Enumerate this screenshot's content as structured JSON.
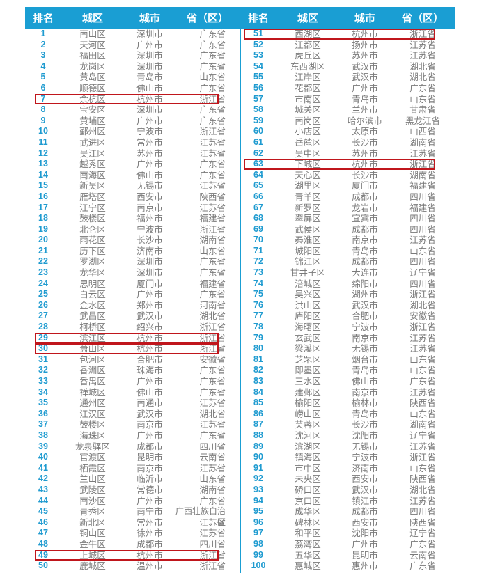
{
  "headers": {
    "rank": "排名",
    "district": "城区",
    "city": "城市",
    "province": "省（区）"
  },
  "colors": {
    "header_bg": "#1a9ed3",
    "rank_text": "#1f9bd0",
    "cell_text": "#7a7a7a",
    "highlight_border": "#c0161c"
  },
  "highlighted_ranks": [
    7,
    29,
    30,
    49,
    51,
    63
  ],
  "left_rows": [
    {
      "rank": "1",
      "district": "南山区",
      "city": "深圳市",
      "province": "广东省"
    },
    {
      "rank": "2",
      "district": "天河区",
      "city": "广州市",
      "province": "广东省"
    },
    {
      "rank": "3",
      "district": "福田区",
      "city": "深圳市",
      "province": "广东省"
    },
    {
      "rank": "4",
      "district": "龙岗区",
      "city": "深圳市",
      "province": "广东省"
    },
    {
      "rank": "5",
      "district": "黄岛区",
      "city": "青岛市",
      "province": "山东省"
    },
    {
      "rank": "6",
      "district": "顺德区",
      "city": "佛山市",
      "province": "广东省"
    },
    {
      "rank": "7",
      "district": "余杭区",
      "city": "杭州市",
      "province": "浙江省",
      "highlight": true
    },
    {
      "rank": "8",
      "district": "宝安区",
      "city": "深圳市",
      "province": "广东省"
    },
    {
      "rank": "9",
      "district": "黄埔区",
      "city": "广州市",
      "province": "广东省"
    },
    {
      "rank": "10",
      "district": "鄞州区",
      "city": "宁波市",
      "province": "浙江省"
    },
    {
      "rank": "11",
      "district": "武进区",
      "city": "常州市",
      "province": "江苏省"
    },
    {
      "rank": "12",
      "district": "吴江区",
      "city": "苏州市",
      "province": "江苏省"
    },
    {
      "rank": "13",
      "district": "越秀区",
      "city": "广州市",
      "province": "广东省"
    },
    {
      "rank": "14",
      "district": "南海区",
      "city": "佛山市",
      "province": "广东省"
    },
    {
      "rank": "15",
      "district": "新吴区",
      "city": "无锡市",
      "province": "江苏省"
    },
    {
      "rank": "16",
      "district": "雁塔区",
      "city": "西安市",
      "province": "陕西省"
    },
    {
      "rank": "17",
      "district": "江宁区",
      "city": "南京市",
      "province": "江苏省"
    },
    {
      "rank": "18",
      "district": "鼓楼区",
      "city": "福州市",
      "province": "福建省"
    },
    {
      "rank": "19",
      "district": "北仑区",
      "city": "宁波市",
      "province": "浙江省"
    },
    {
      "rank": "20",
      "district": "雨花区",
      "city": "长沙市",
      "province": "湖南省"
    },
    {
      "rank": "21",
      "district": "历下区",
      "city": "济南市",
      "province": "山东省"
    },
    {
      "rank": "22",
      "district": "罗湖区",
      "city": "深圳市",
      "province": "广东省"
    },
    {
      "rank": "23",
      "district": "龙华区",
      "city": "深圳市",
      "province": "广东省"
    },
    {
      "rank": "24",
      "district": "思明区",
      "city": "厦门市",
      "province": "福建省"
    },
    {
      "rank": "25",
      "district": "白云区",
      "city": "广州市",
      "province": "广东省"
    },
    {
      "rank": "26",
      "district": "金水区",
      "city": "郑州市",
      "province": "河南省"
    },
    {
      "rank": "27",
      "district": "武昌区",
      "city": "武汉市",
      "province": "湖北省"
    },
    {
      "rank": "28",
      "district": "柯桥区",
      "city": "绍兴市",
      "province": "浙江省"
    },
    {
      "rank": "29",
      "district": "滨江区",
      "city": "杭州市",
      "province": "浙江省",
      "highlight": true
    },
    {
      "rank": "30",
      "district": "萧山区",
      "city": "杭州市",
      "province": "浙江省",
      "highlight": true
    },
    {
      "rank": "31",
      "district": "包河区",
      "city": "合肥市",
      "province": "安徽省"
    },
    {
      "rank": "32",
      "district": "香洲区",
      "city": "珠海市",
      "province": "广东省"
    },
    {
      "rank": "33",
      "district": "番禺区",
      "city": "广州市",
      "province": "广东省"
    },
    {
      "rank": "34",
      "district": "禅城区",
      "city": "佛山市",
      "province": "广东省"
    },
    {
      "rank": "35",
      "district": "通州区",
      "city": "南通市",
      "province": "江苏省"
    },
    {
      "rank": "36",
      "district": "江汉区",
      "city": "武汉市",
      "province": "湖北省"
    },
    {
      "rank": "37",
      "district": "鼓楼区",
      "city": "南京市",
      "province": "江苏省"
    },
    {
      "rank": "38",
      "district": "海珠区",
      "city": "广州市",
      "province": "广东省"
    },
    {
      "rank": "39",
      "district": "龙泉驿区",
      "city": "成都市",
      "province": "四川省"
    },
    {
      "rank": "40",
      "district": "官渡区",
      "city": "昆明市",
      "province": "云南省"
    },
    {
      "rank": "41",
      "district": "栖霞区",
      "city": "南京市",
      "province": "江苏省"
    },
    {
      "rank": "42",
      "district": "兰山区",
      "city": "临沂市",
      "province": "山东省"
    },
    {
      "rank": "43",
      "district": "武陵区",
      "city": "常德市",
      "province": "湖南省"
    },
    {
      "rank": "44",
      "district": "南沙区",
      "city": "广州市",
      "province": "广东省"
    },
    {
      "rank": "45",
      "district": "青秀区",
      "city": "南宁市",
      "province": "广西壮族自治区"
    },
    {
      "rank": "46",
      "district": "新北区",
      "city": "常州市",
      "province": "江苏省"
    },
    {
      "rank": "47",
      "district": "铜山区",
      "city": "徐州市",
      "province": "江苏省"
    },
    {
      "rank": "48",
      "district": "金牛区",
      "city": "成都市",
      "province": "四川省"
    },
    {
      "rank": "49",
      "district": "上城区",
      "city": "杭州市",
      "province": "浙江省",
      "highlight": true
    },
    {
      "rank": "50",
      "district": "鹿城区",
      "city": "温州市",
      "province": "浙江省"
    }
  ],
  "right_rows": [
    {
      "rank": "51",
      "district": "西湖区",
      "city": "杭州市",
      "province": "浙江省",
      "highlight": true
    },
    {
      "rank": "52",
      "district": "江都区",
      "city": "扬州市",
      "province": "江苏省"
    },
    {
      "rank": "53",
      "district": "虎丘区",
      "city": "苏州市",
      "province": "江苏省"
    },
    {
      "rank": "54",
      "district": "东西湖区",
      "city": "武汉市",
      "province": "湖北省"
    },
    {
      "rank": "55",
      "district": "江岸区",
      "city": "武汉市",
      "province": "湖北省"
    },
    {
      "rank": "56",
      "district": "花都区",
      "city": "广州市",
      "province": "广东省"
    },
    {
      "rank": "57",
      "district": "市南区",
      "city": "青岛市",
      "province": "山东省"
    },
    {
      "rank": "58",
      "district": "城关区",
      "city": "兰州市",
      "province": "甘肃省"
    },
    {
      "rank": "59",
      "district": "南岗区",
      "city": "哈尔滨市",
      "province": "黑龙江省"
    },
    {
      "rank": "60",
      "district": "小店区",
      "city": "太原市",
      "province": "山西省"
    },
    {
      "rank": "61",
      "district": "岳麓区",
      "city": "长沙市",
      "province": "湖南省"
    },
    {
      "rank": "62",
      "district": "吴中区",
      "city": "苏州市",
      "province": "江苏省"
    },
    {
      "rank": "63",
      "district": "下城区",
      "city": "杭州市",
      "province": "浙江省",
      "highlight": true
    },
    {
      "rank": "64",
      "district": "天心区",
      "city": "长沙市",
      "province": "湖南省"
    },
    {
      "rank": "65",
      "district": "湖里区",
      "city": "厦门市",
      "province": "福建省"
    },
    {
      "rank": "66",
      "district": "青羊区",
      "city": "成都市",
      "province": "四川省"
    },
    {
      "rank": "67",
      "district": "新罗区",
      "city": "龙岩市",
      "province": "福建省"
    },
    {
      "rank": "68",
      "district": "翠屏区",
      "city": "宜宾市",
      "province": "四川省"
    },
    {
      "rank": "69",
      "district": "武侯区",
      "city": "成都市",
      "province": "四川省"
    },
    {
      "rank": "70",
      "district": "秦淮区",
      "city": "南京市",
      "province": "江苏省"
    },
    {
      "rank": "71",
      "district": "城阳区",
      "city": "青岛市",
      "province": "山东省"
    },
    {
      "rank": "72",
      "district": "锦江区",
      "city": "成都市",
      "province": "四川省"
    },
    {
      "rank": "73",
      "district": "甘井子区",
      "city": "大连市",
      "province": "辽宁省"
    },
    {
      "rank": "74",
      "district": "涪城区",
      "city": "绵阳市",
      "province": "四川省"
    },
    {
      "rank": "75",
      "district": "吴兴区",
      "city": "湖州市",
      "province": "浙江省"
    },
    {
      "rank": "76",
      "district": "洪山区",
      "city": "武汉市",
      "province": "湖北省"
    },
    {
      "rank": "77",
      "district": "庐阳区",
      "city": "合肥市",
      "province": "安徽省"
    },
    {
      "rank": "78",
      "district": "海曙区",
      "city": "宁波市",
      "province": "浙江省"
    },
    {
      "rank": "79",
      "district": "玄武区",
      "city": "南京市",
      "province": "江苏省"
    },
    {
      "rank": "80",
      "district": "梁溪区",
      "city": "无锡市",
      "province": "江苏省"
    },
    {
      "rank": "81",
      "district": "芝罘区",
      "city": "烟台市",
      "province": "山东省"
    },
    {
      "rank": "82",
      "district": "即墨区",
      "city": "青岛市",
      "province": "山东省"
    },
    {
      "rank": "83",
      "district": "三水区",
      "city": "佛山市",
      "province": "广东省"
    },
    {
      "rank": "84",
      "district": "建邺区",
      "city": "南京市",
      "province": "江苏省"
    },
    {
      "rank": "85",
      "district": "榆阳区",
      "city": "榆林市",
      "province": "陕西省"
    },
    {
      "rank": "86",
      "district": "崂山区",
      "city": "青岛市",
      "province": "山东省"
    },
    {
      "rank": "87",
      "district": "芙蓉区",
      "city": "长沙市",
      "province": "湖南省"
    },
    {
      "rank": "88",
      "district": "沈河区",
      "city": "沈阳市",
      "province": "辽宁省"
    },
    {
      "rank": "89",
      "district": "滨湖区",
      "city": "无锡市",
      "province": "江苏省"
    },
    {
      "rank": "90",
      "district": "镇海区",
      "city": "宁波市",
      "province": "浙江省"
    },
    {
      "rank": "91",
      "district": "市中区",
      "city": "济南市",
      "province": "山东省"
    },
    {
      "rank": "92",
      "district": "未央区",
      "city": "西安市",
      "province": "陕西省"
    },
    {
      "rank": "93",
      "district": "硚口区",
      "city": "武汉市",
      "province": "湖北省"
    },
    {
      "rank": "94",
      "district": "京口区",
      "city": "镇江市",
      "province": "江苏省"
    },
    {
      "rank": "95",
      "district": "成华区",
      "city": "成都市",
      "province": "四川省"
    },
    {
      "rank": "96",
      "district": "碑林区",
      "city": "西安市",
      "province": "陕西省"
    },
    {
      "rank": "97",
      "district": "和平区",
      "city": "沈阳市",
      "province": "辽宁省"
    },
    {
      "rank": "98",
      "district": "荔湾区",
      "city": "广州市",
      "province": "广东省"
    },
    {
      "rank": "99",
      "district": "五华区",
      "city": "昆明市",
      "province": "云南省"
    },
    {
      "rank": "100",
      "district": "惠城区",
      "city": "惠州市",
      "province": "广东省"
    }
  ]
}
